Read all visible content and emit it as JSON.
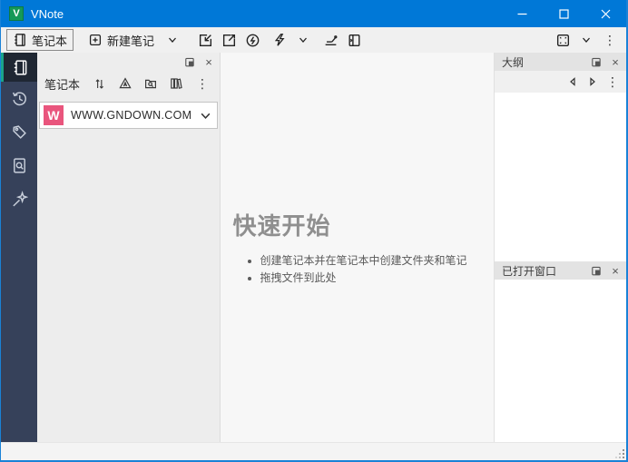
{
  "window": {
    "title": "VNote"
  },
  "toolbar": {
    "notebook_label": "笔记本",
    "new_note_label": "新建笔记"
  },
  "activity_bar": {
    "items": [
      "notebooks",
      "history",
      "tags",
      "search",
      "snippets"
    ],
    "active_item": "notebooks"
  },
  "notebook_panel": {
    "header_title": "笔记本",
    "notebook_initial": "W",
    "notebook_name": "WWW.GNDOWN.COM"
  },
  "main": {
    "heading": "快速开始",
    "bullets": [
      "创建笔记本并在笔记本中创建文件夹和笔记",
      "拖拽文件到此处"
    ]
  },
  "outline_panel": {
    "title": "大纲"
  },
  "opened_windows_panel": {
    "title": "已打开窗口"
  },
  "icons": {
    "close": "×",
    "more": "⋮"
  },
  "colors": {
    "titlebar": "#0078d7",
    "window_border": "#1a82d7",
    "sidebar": "#36415a",
    "sidebar_active_indicator": "#1aa38b",
    "notebook_badge": "#e9557d",
    "heading_text": "#8f8f8f"
  }
}
